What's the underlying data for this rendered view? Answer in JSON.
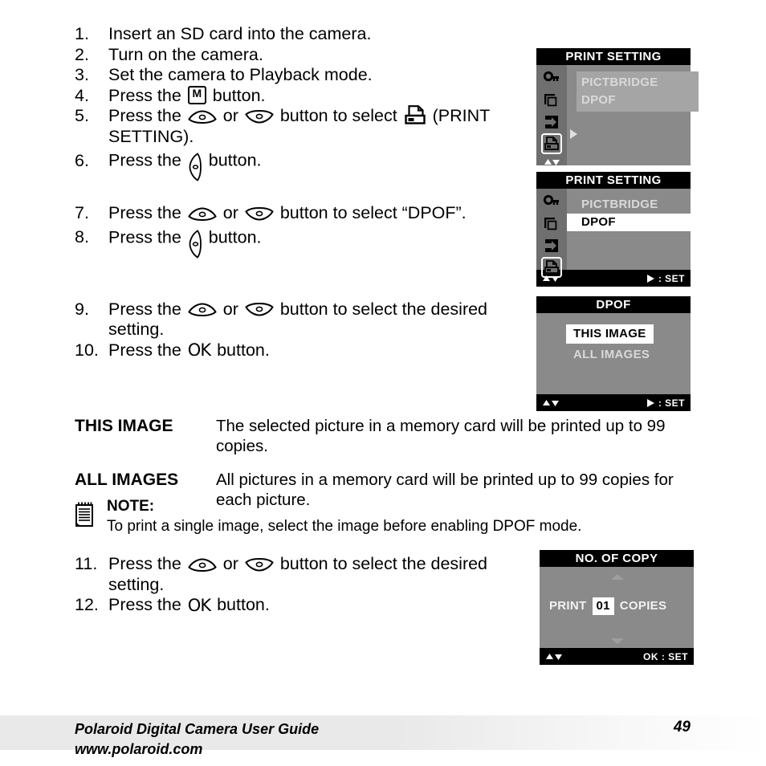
{
  "document": {
    "page_number": "49",
    "footer_line1": "Polaroid Digital Camera User Guide",
    "footer_line2": "www.polaroid.com"
  },
  "steps": [
    {
      "num": "1.",
      "pre": "Insert an SD card into the camera.",
      "post": ""
    },
    {
      "num": "2.",
      "pre": "Turn on the camera.",
      "post": ""
    },
    {
      "num": "3.",
      "pre": "Set the camera to Playback mode.",
      "post": ""
    },
    {
      "num": "4.",
      "pre": "Press the ",
      "icon": "m-button-icon",
      "post": " button."
    },
    {
      "num": "5.",
      "pre": "Press the ",
      "mid": " or ",
      "post": " button to select ",
      "tail": " (PRINT SETTING)."
    },
    {
      "num": "6.",
      "pre": "Press the ",
      "icon": "right-button-icon",
      "post": " button."
    },
    {
      "num": "7.",
      "pre": "Press the ",
      "mid": " or ",
      "post": " button to select “DPOF”."
    },
    {
      "num": "8.",
      "pre": "Press the ",
      "icon": "right-button-icon",
      "post": " button."
    },
    {
      "num": "9.",
      "pre": "Press the ",
      "mid": " or ",
      "post": " button to select the desired setting."
    },
    {
      "num": "10.",
      "pre": "Press the ",
      "icon": "ok-button-icon",
      "post": " button."
    },
    {
      "num": "11.",
      "pre": "Press the ",
      "mid": " or ",
      "post": " button to select the desired setting."
    },
    {
      "num": "12.",
      "pre": "Press the ",
      "icon": "ok-button-icon",
      "post": " button."
    }
  ],
  "definitions": [
    {
      "term": "THIS IMAGE",
      "text": "The selected picture in a memory card will be printed up to 99 copies."
    },
    {
      "term": "ALL IMAGES",
      "text": "All pictures in a memory card will be printed up to 99 copies for each picture."
    }
  ],
  "note": {
    "title": "NOTE:",
    "text": "To print a single image, select the image before enabling DPOF mode."
  },
  "screens": [
    {
      "id": "print-setting-pictbridge",
      "title": "PRINT SETTING",
      "sidebar_icons": [
        "key-icon",
        "copy-icon",
        "transfer-icon",
        "printer-icon",
        "updown-icon"
      ],
      "selected_sidebar_index": 3,
      "options": [
        {
          "label": "PICTBRIDGE",
          "state": "dim"
        },
        {
          "label": "DPOF",
          "state": "dim"
        }
      ],
      "has_cursor_arrow": true,
      "footer": null
    },
    {
      "id": "print-setting-dpof",
      "title": "PRINT SETTING",
      "sidebar_icons": [
        "key-icon",
        "copy-icon",
        "transfer-icon",
        "printer-icon"
      ],
      "selected_sidebar_index": 3,
      "options": [
        {
          "label": "PICTBRIDGE",
          "state": "dim"
        },
        {
          "label": "DPOF",
          "state": "selected"
        }
      ],
      "has_cursor_arrow": false,
      "footer": {
        "left": "updown-icon",
        "right_icon": "right-triangle-icon",
        "right_label": ":  SET"
      }
    },
    {
      "id": "dpof-menu",
      "title": "DPOF",
      "sidebar_icons": [],
      "options": [
        {
          "label": "THIS IMAGE",
          "state": "selected"
        },
        {
          "label": "ALL IMAGES",
          "state": "dim"
        }
      ],
      "has_cursor_arrow": false,
      "footer": {
        "left": "updown-icon",
        "right_icon": "right-triangle-icon",
        "right_label": ":  SET"
      }
    },
    {
      "id": "no-of-copy",
      "title": "NO. OF COPY",
      "sidebar_icons": [],
      "copy_row": {
        "prefix": "PRINT",
        "value": "01",
        "suffix": "COPIES"
      },
      "footer": {
        "left": "updown-icon",
        "right_icon": null,
        "right_label": "OK :  SET"
      }
    }
  ],
  "colors": {
    "lcd_background": "#8a8a8a",
    "lcd_sidebar": "#6f6f6f",
    "lcd_titlebar": "#000000",
    "lcd_highlight": "#ffffff",
    "lcd_dim_text": "#d9d9d9",
    "footer_band": "#e9e9e9"
  }
}
